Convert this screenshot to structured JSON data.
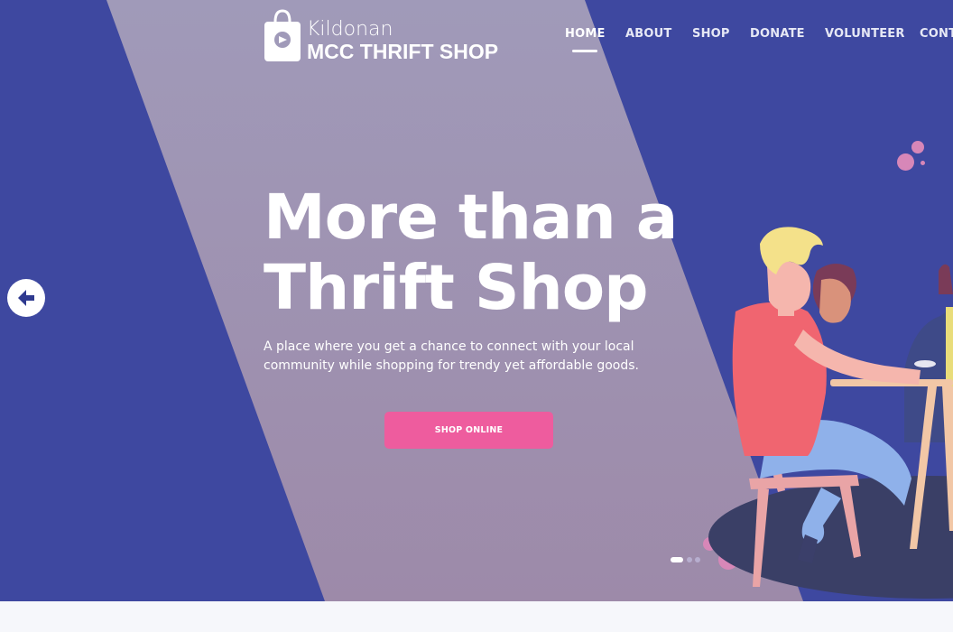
{
  "brand": {
    "name_top": "Kildonan",
    "name_bottom": "MCC THRIFT SHOP",
    "logo_icon": "shopping-bag-icon"
  },
  "nav": {
    "items": [
      {
        "label": "HOME",
        "active": true
      },
      {
        "label": "ABOUT",
        "active": false
      },
      {
        "label": "SHOP",
        "active": false
      },
      {
        "label": "DONATE",
        "active": false
      },
      {
        "label": "VOLUNTEER",
        "active": false
      },
      {
        "label": "CONT",
        "active": false
      }
    ]
  },
  "hero": {
    "headline_line1": "More than a",
    "headline_line2": "Thrift Shop",
    "subtitle_line1": "A place where you get a chance to connect with your local",
    "subtitle_line2": "community while shopping for trendy yet affordable goods.",
    "cta_label": "SHOP ONLINE",
    "prev_icon": "arrow-left-icon",
    "slides": {
      "count": 3,
      "active": 1
    }
  },
  "colors": {
    "hero_bg": "#3e48a0",
    "band": "#9d93b3",
    "accent_pink": "#ee5c9e",
    "text": "#ffffff"
  }
}
